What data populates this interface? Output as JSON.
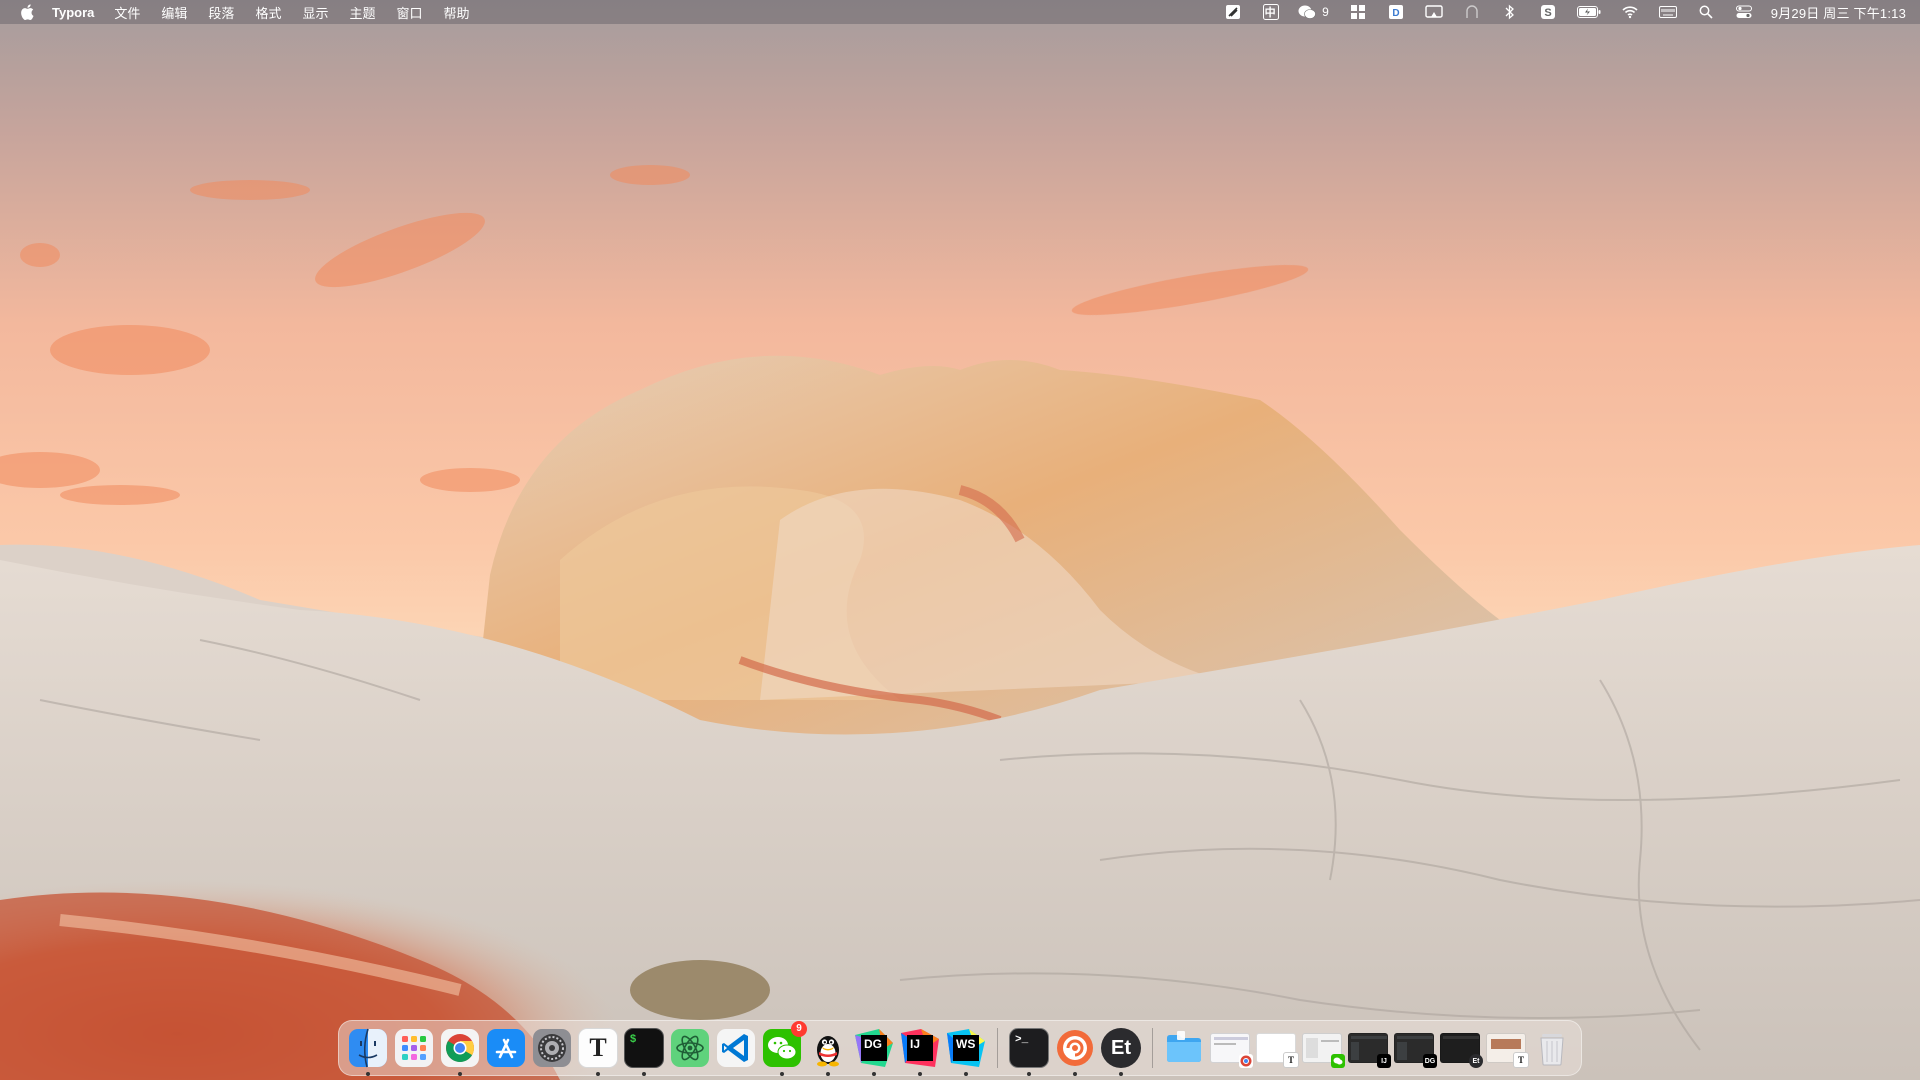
{
  "menubar": {
    "app_name": "Typora",
    "menus": [
      "文件",
      "编辑",
      "段落",
      "格式",
      "显示",
      "主题",
      "窗口",
      "帮助"
    ],
    "status_icons": [
      {
        "name": "sketch-status-icon"
      },
      {
        "name": "input-method-status",
        "label": "中"
      },
      {
        "name": "wechat-status-icon",
        "count": "9"
      },
      {
        "name": "grid-status-icon"
      },
      {
        "name": "dict-status-icon"
      },
      {
        "name": "screen-mirror-icon"
      },
      {
        "name": "airplay-icon"
      },
      {
        "name": "bluetooth-icon"
      },
      {
        "name": "sync-s-icon"
      },
      {
        "name": "battery-icon"
      },
      {
        "name": "wifi-icon"
      },
      {
        "name": "keyboard-icon"
      },
      {
        "name": "spotlight-search-icon"
      },
      {
        "name": "control-center-icon"
      }
    ],
    "input_method_label": "中",
    "wechat_count": "9",
    "clock": "9月29日 周三 下午1:13"
  },
  "dock": {
    "apps": [
      {
        "name": "finder",
        "running": true
      },
      {
        "name": "launchpad",
        "running": false
      },
      {
        "name": "chrome",
        "running": true
      },
      {
        "name": "app-store",
        "running": false
      },
      {
        "name": "system-preferences",
        "running": false
      },
      {
        "name": "typora",
        "running": true,
        "label": "T"
      },
      {
        "name": "iterm",
        "running": true,
        "label": "$"
      },
      {
        "name": "atom",
        "running": false
      },
      {
        "name": "vscode",
        "running": false
      },
      {
        "name": "wechat",
        "running": true,
        "badge": "9"
      },
      {
        "name": "qq",
        "running": true
      },
      {
        "name": "datagrip",
        "running": true,
        "label": "DG"
      },
      {
        "name": "intellij-idea",
        "running": true,
        "label": "IJ"
      },
      {
        "name": "webstorm",
        "running": true,
        "label": "WS"
      }
    ],
    "pinned": [
      {
        "name": "terminal",
        "running": true,
        "label": ">_"
      },
      {
        "name": "scrobbler",
        "running": true
      },
      {
        "name": "et-app",
        "running": true,
        "label": "Et"
      }
    ],
    "trash_label": "Trash",
    "wechat_badge": "9",
    "typora_label": "T",
    "iterm_label": "$",
    "datagrip_label": "DG",
    "idea_label": "IJ",
    "webstorm_label": "WS",
    "terminal_label": ">_",
    "et_label": "Et"
  },
  "colors": {
    "menubar": "#6e686e",
    "dock": "#ebe1dc",
    "sky_top": "#a79e9d",
    "sky_glow": "#f9c4a5",
    "rock": "#d8cfc8",
    "red_sand": "#c9583a"
  }
}
